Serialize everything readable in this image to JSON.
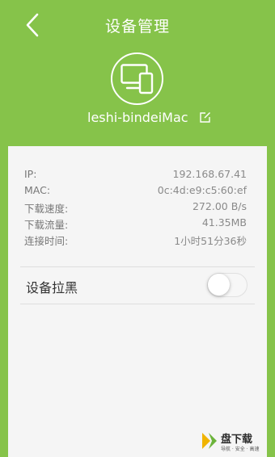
{
  "header": {
    "title": "设备管理",
    "back_icon": "chevron-left-icon"
  },
  "device": {
    "icon": "devices-icon",
    "name": "leshi-bindeiMac",
    "edit_icon": "edit-icon"
  },
  "info": [
    {
      "label": "IP:",
      "value": "192.168.67.41"
    },
    {
      "label": "MAC:",
      "value": "0c:4d:e9:c5:60:ef"
    },
    {
      "label": "下载速度:",
      "value": "272.00 B/s"
    },
    {
      "label": "下载流量:",
      "value": "41.35MB"
    },
    {
      "label": "连接时间:",
      "value": "1小时51分36秒"
    }
  ],
  "block": {
    "label": "设备拉黑",
    "enabled": false
  },
  "watermark": {
    "brand": "盘下载",
    "tagline": "导航 · 安全 · 高速"
  },
  "colors": {
    "background": "#86c34a",
    "card": "#f5f5f5",
    "text_primary": "#333333",
    "text_secondary": "#777777"
  }
}
